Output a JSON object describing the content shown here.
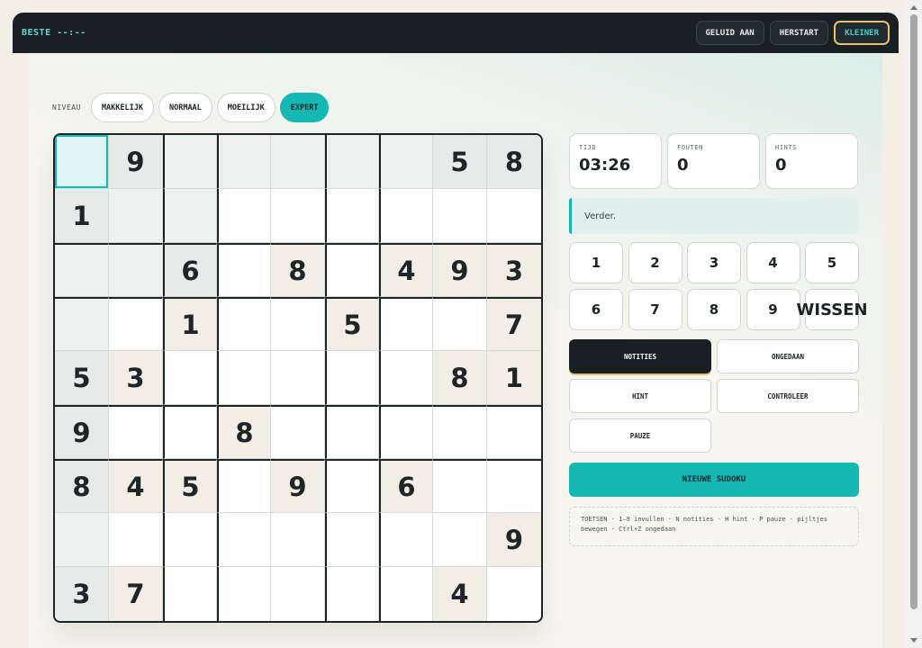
{
  "topbar": {
    "best": "BESTE --:--",
    "sound_label": "GELUID AAN",
    "restart_label": "HERSTART",
    "size_label": "KLEINER"
  },
  "levels": {
    "label": "NIVEAU",
    "options": [
      "MAKKELIJK",
      "NORMAAL",
      "MOEILIJK",
      "EXPERT"
    ],
    "active": "EXPERT"
  },
  "board": {
    "selected": [
      0,
      0
    ],
    "givens": [
      [
        0,
        9,
        0,
        0,
        0,
        0,
        0,
        5,
        8
      ],
      [
        1,
        0,
        0,
        0,
        0,
        0,
        0,
        0,
        0
      ],
      [
        0,
        0,
        6,
        0,
        8,
        0,
        4,
        9,
        3
      ],
      [
        0,
        0,
        1,
        0,
        0,
        5,
        0,
        0,
        7
      ],
      [
        5,
        3,
        0,
        0,
        0,
        0,
        0,
        8,
        1
      ],
      [
        9,
        0,
        0,
        8,
        0,
        0,
        0,
        0,
        0
      ],
      [
        8,
        4,
        5,
        0,
        9,
        0,
        6,
        0,
        0
      ],
      [
        0,
        0,
        0,
        0,
        0,
        0,
        0,
        0,
        9
      ],
      [
        3,
        7,
        0,
        0,
        0,
        0,
        0,
        4,
        0
      ]
    ]
  },
  "stats": {
    "time_label": "TIJD",
    "time_value": "03:26",
    "errors_label": "FOUTEN",
    "errors_value": "0",
    "hints_label": "HINTS",
    "hints_value": "0"
  },
  "message": "Verder.",
  "numpad": [
    "1",
    "2",
    "3",
    "4",
    "5",
    "6",
    "7",
    "8",
    "9",
    "WISSEN"
  ],
  "actions": {
    "notes": "NOTITIES",
    "undo": "ONGEDAAN",
    "hint": "HINT",
    "check": "CONTROLEER",
    "pause": "PAUZE"
  },
  "new_sudoku": "NIEUWE SUDOKU",
  "keys_help": "TOETSEN · 1–9 invullen · N notities · H hint · P pauze · pijltjes bewegen · Ctrl+Z ongedaan",
  "colors": {
    "accent": "#16b8b4",
    "dark": "#182024",
    "gold": "#e6c46c",
    "background": "#f3efe7"
  }
}
